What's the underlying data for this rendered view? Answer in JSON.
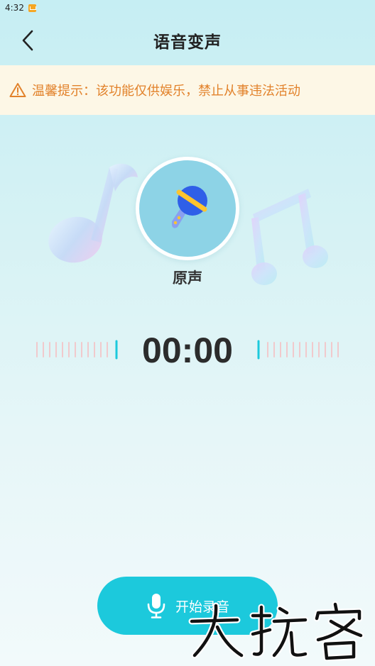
{
  "status_bar": {
    "time": "4:32"
  },
  "header": {
    "title": "语音变声"
  },
  "notice": {
    "text": "温馨提示：该功能仅供娱乐，禁止从事违法活动"
  },
  "effect": {
    "label": "原声",
    "icon": "microphone-icon"
  },
  "timer": {
    "value": "00:00"
  },
  "record_button": {
    "label": "开始录音",
    "icon": "mic-icon"
  },
  "watermark": {
    "text": "大玩客"
  },
  "colors": {
    "accent": "#1cc9dc",
    "notice_text": "#e2822b",
    "notice_bg": "#fdf7e6",
    "mic_head": "#2f5fe8",
    "mic_band": "#ffc42e"
  }
}
